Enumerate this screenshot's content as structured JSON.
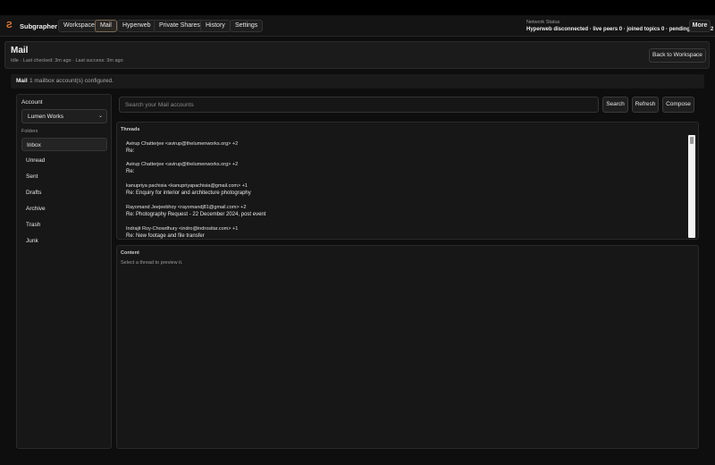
{
  "app": {
    "brand": "Subgrapher",
    "logo_glyph": "Ƨ"
  },
  "nav": {
    "workspace": "Workspace",
    "mail": "Mail",
    "hyperweb": "Hyperweb",
    "private_shares": "Private Shares",
    "history": "History",
    "settings": "Settings",
    "more": "More"
  },
  "network": {
    "label": "Network Status",
    "value": "Hyperweb disconnected · live peers 0 · joined topics 0 · pending private 2"
  },
  "header": {
    "title": "Mail",
    "subtitle": "Idle · Last checked: 3m ago · Last success: 3m ago",
    "back_button": "Back to Workspace"
  },
  "infobar": {
    "title": "Mail",
    "message": "1 mailbox account(s) configured."
  },
  "sidebar": {
    "account_label": "Account",
    "account_selected": "Lumen Works",
    "folders_label": "Folders",
    "folders": [
      "Inbox",
      "Unread",
      "Sent",
      "Drafts",
      "Archive",
      "Trash",
      "Junk"
    ],
    "active_folder": "Inbox"
  },
  "search": {
    "placeholder": "Search your Mail accounts",
    "search_button": "Search",
    "refresh_button": "Refresh",
    "compose_button": "Compose"
  },
  "threads": {
    "header": "Threads",
    "items": [
      {
        "from": "Avirup Chatterjee <avirup@thelumenworks.org> +2",
        "subject": "Re:"
      },
      {
        "from": "Avirup Chatterjee <avirup@thelumenworks.org> +2",
        "subject": "Re:"
      },
      {
        "from": "kanupriya pachisia <kanupriyapachisia@gmail.com> +1",
        "subject": "Re: Enquiry for interior and architecture photography"
      },
      {
        "from": "Rayomand Jeejeebhoy <rayomandj81@gmail.com> +2",
        "subject": "Re: Photography Request - 22 December 2024, post event"
      },
      {
        "from": "Indrajit Roy-Chowdhury <indro@indrositar.com> +1",
        "subject": "Re: New footage and file transfer"
      }
    ]
  },
  "content": {
    "header": "Content",
    "empty_text": "Select a thread to preview it."
  },
  "colors": {
    "accent": "#e07a3a",
    "background": "#0e0e0e",
    "panel": "#171717"
  }
}
